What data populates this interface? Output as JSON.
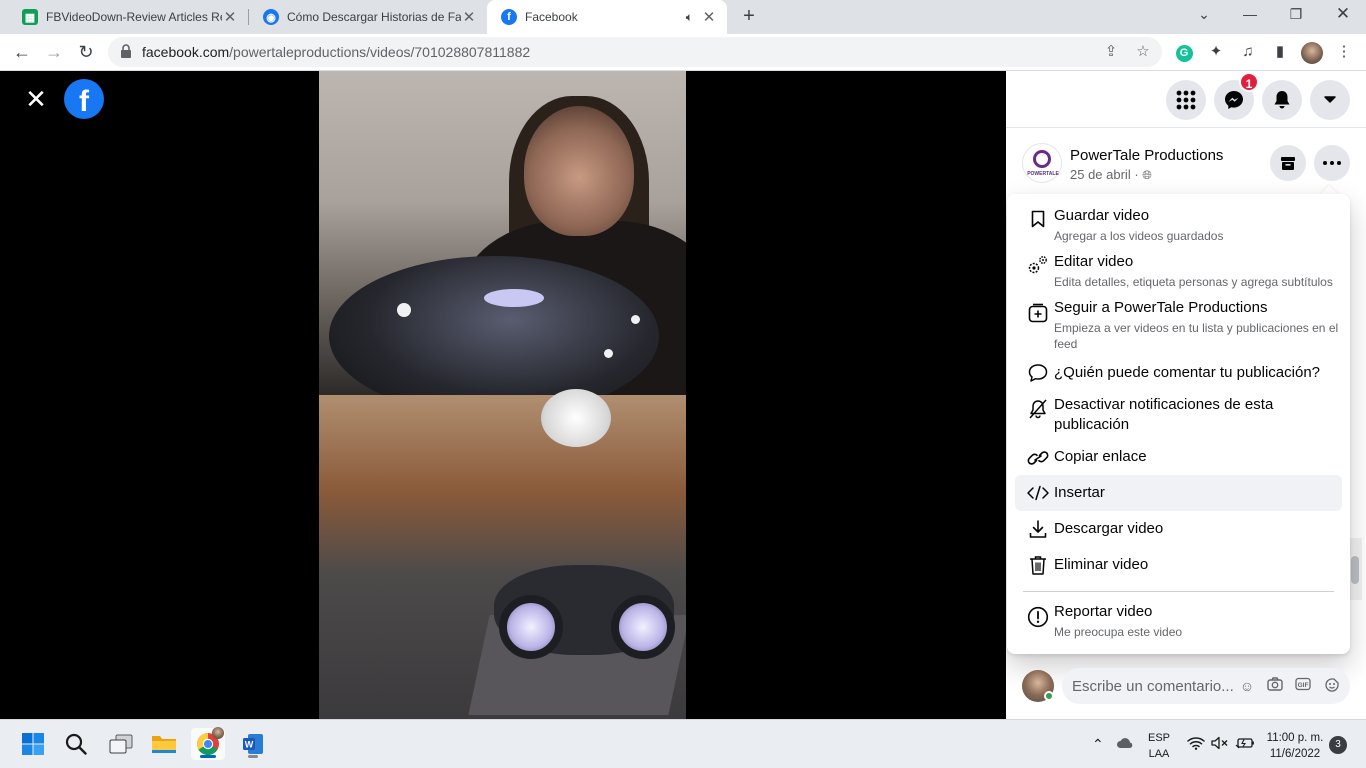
{
  "browser": {
    "tabs": [
      {
        "title": "FBVideoDown-Review Articles Re",
        "active": false
      },
      {
        "title": "Cómo Descargar Historias de Fac",
        "active": false
      },
      {
        "title": "Facebook",
        "active": true
      }
    ],
    "url_host": "facebook.com",
    "url_path": "/powertaleproductions/videos/701028807811882"
  },
  "panel": {
    "messenger_badge": "1",
    "page_name": "PowerTale Productions",
    "post_date": "25 de abril ·",
    "avatar_caption": "POWERTALE"
  },
  "menu": {
    "items": [
      {
        "label": "Guardar video",
        "sub": "Agregar a los videos guardados",
        "icon": "bookmark-icon"
      },
      {
        "label": "Editar video",
        "sub": "Edita detalles, etiqueta personas y agrega subtítulos",
        "icon": "gear-icon"
      },
      {
        "label": "Seguir a PowerTale Productions",
        "sub": "Empieza a ver videos en tu lista y publicaciones en el feed",
        "icon": "add-box-icon"
      },
      {
        "label": "¿Quién puede comentar tu publicación?",
        "sub": "",
        "icon": "comment-icon"
      },
      {
        "label": "Desactivar notificaciones de esta publicación",
        "sub": "",
        "icon": "bell-off-icon"
      },
      {
        "label": "Copiar enlace",
        "sub": "",
        "icon": "link-icon"
      },
      {
        "label": "Insertar",
        "sub": "",
        "icon": "code-icon"
      },
      {
        "label": "Descargar video",
        "sub": "",
        "icon": "download-icon"
      },
      {
        "label": "Eliminar video",
        "sub": "",
        "icon": "trash-icon"
      },
      {
        "label": "Reportar video",
        "sub": "Me preocupa este video",
        "icon": "alert-icon"
      }
    ]
  },
  "comment": {
    "placeholder": "Escribe un comentario..."
  },
  "taskbar": {
    "lang_top": "ESP",
    "lang_bottom": "LAA",
    "time": "11:00 p. m.",
    "date": "11/6/2022",
    "notif_count": "3"
  },
  "colors": {
    "facebook_blue": "#1877f2",
    "badge_red": "#e41e3f",
    "menu_highlight": "#f0f2f5"
  }
}
